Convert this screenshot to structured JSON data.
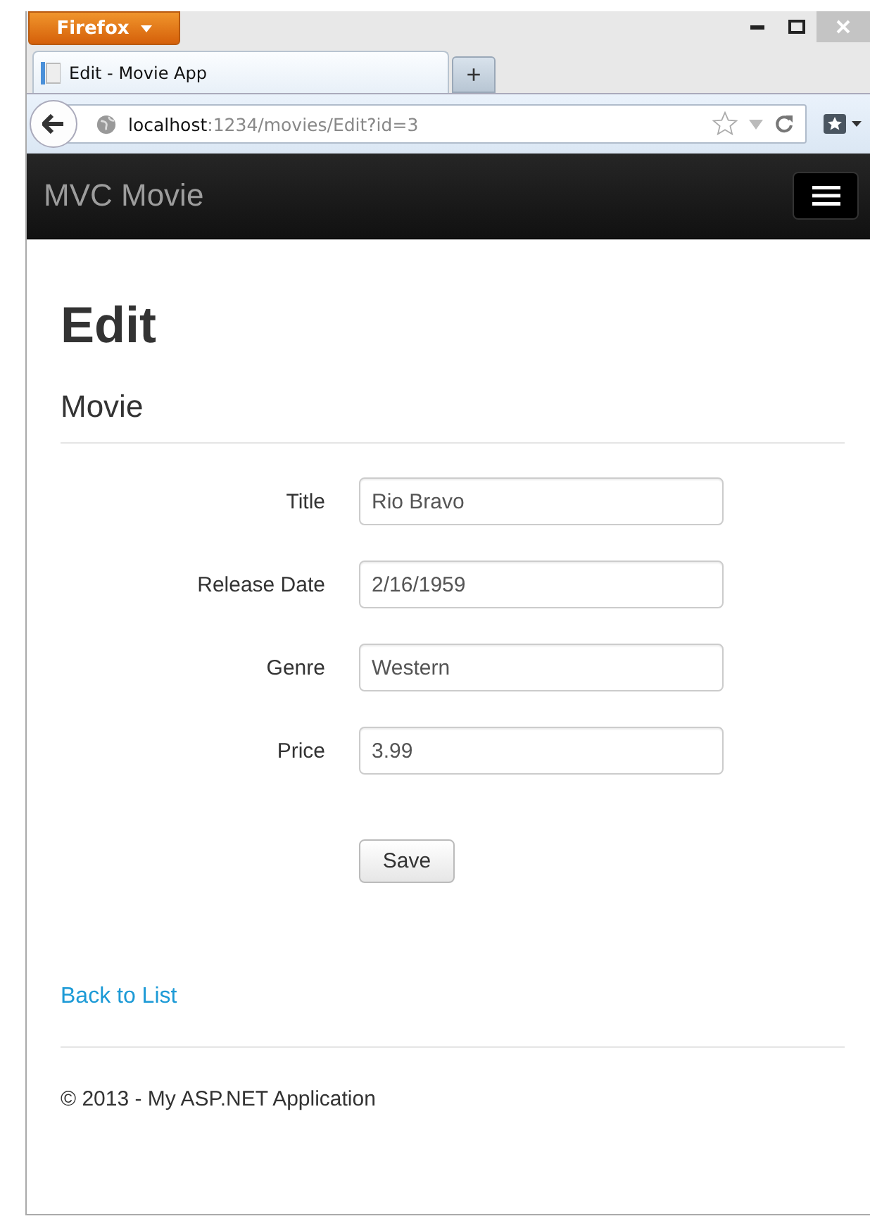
{
  "browser": {
    "menu_button": "Firefox",
    "tabs": [
      {
        "title": "Edit - Movie App",
        "selected": true
      }
    ],
    "new_tab": "+",
    "address": {
      "host": "localhost",
      "path": ":1234/movies/Edit?id=3"
    }
  },
  "navbar": {
    "brand": "MVC Movie"
  },
  "heading": "Edit",
  "subheading": "Movie",
  "fields": [
    {
      "label": "Title",
      "value": "Rio Bravo"
    },
    {
      "label": "Release Date",
      "value": "2/16/1959"
    },
    {
      "label": "Genre",
      "value": "Western"
    },
    {
      "label": "Price",
      "value": "3.99"
    }
  ],
  "submit": "Save",
  "back_link": "Back to List",
  "footer": "© 2013 - My ASP.NET Application"
}
